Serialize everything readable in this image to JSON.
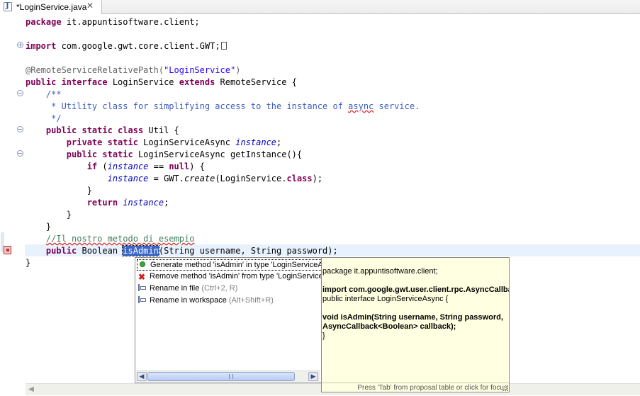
{
  "tab": {
    "title": "*LoginService.java",
    "close_symbol": "✕",
    "icon_letter": "J"
  },
  "code_lines": {
    "l1_kw": "package",
    "l1_rest": " it.appuntisoftware.client;",
    "l3_kw": "import",
    "l3_rest": " com.google.gwt.core.client.GWT;",
    "l5_ann": "@RemoteServiceRelativePath(",
    "l5_str": "\"LoginService\"",
    "l5_end": ")",
    "l6_kw1": "public interface",
    "l6_mid": " LoginService ",
    "l6_kw2": "extends",
    "l6_rest": " RemoteService {",
    "l7_com": "    /**",
    "l8_com_a": "     * Utility class for simplifying access to the instance of ",
    "l8_com_spell": "async",
    "l8_com_b": " service.",
    "l9_com": "     */",
    "l10_kw": "    public static class",
    "l10_rest": " Util {",
    "l11_kw": "        private static",
    "l11_mid": " LoginServiceAsync ",
    "l11_var": "instance",
    "l11_end": ";",
    "l12_kw": "        public static",
    "l12_rest": " LoginServiceAsync getInstance(){",
    "l13_kw": "            if",
    "l13_a": " (",
    "l13_var": "instance",
    "l13_b": " == ",
    "l13_kw2": "null",
    "l13_c": ") {",
    "l14_indent": "                ",
    "l14_var": "instance",
    "l14_a": " = GWT.",
    "l14_method": "create",
    "l14_b": "(LoginService.",
    "l14_kw": "class",
    "l14_c": ");",
    "l15": "            }",
    "l16_kw": "            return",
    "l16_sp": " ",
    "l16_var": "instance",
    "l16_end": ";",
    "l17": "        }",
    "l18": "    }",
    "l19_indent": "    ",
    "l19_com": "//Il nostro metodo di esempio",
    "l20_kw": "    public",
    "l20_a": " Boolean ",
    "l20_sel": "isAdmin",
    "l20_b": "(String username, String password);",
    "l21": "}"
  },
  "fold_symbols": {
    "expand": "+",
    "collapse": "−"
  },
  "proposals": [
    {
      "label": "Generate method 'isAdmin' in type 'LoginServiceAsync'",
      "shortcut": ""
    },
    {
      "label": "Remove method 'isAdmin' from type 'LoginService'",
      "shortcut": ""
    },
    {
      "label": "Rename in file ",
      "shortcut": "(Ctrl+2, R)"
    },
    {
      "label": "Rename in workspace ",
      "shortcut": "(Alt+Shift+R)"
    }
  ],
  "proposal_scroll": {
    "left": "◀",
    "right": "▶"
  },
  "info_popup": {
    "lines": [
      "package it.appuntisoftware.client;",
      "import com.google.gwt.user.client.rpc.AsyncCallback;",
      "public interface LoginServiceAsync {",
      "void isAdmin(String username, String password,",
      "AsyncCallback<Boolean> callback);",
      "}"
    ],
    "status": "Press 'Tab' from proposal table or click for focus"
  },
  "editor_scroll": {
    "left": "◀"
  }
}
